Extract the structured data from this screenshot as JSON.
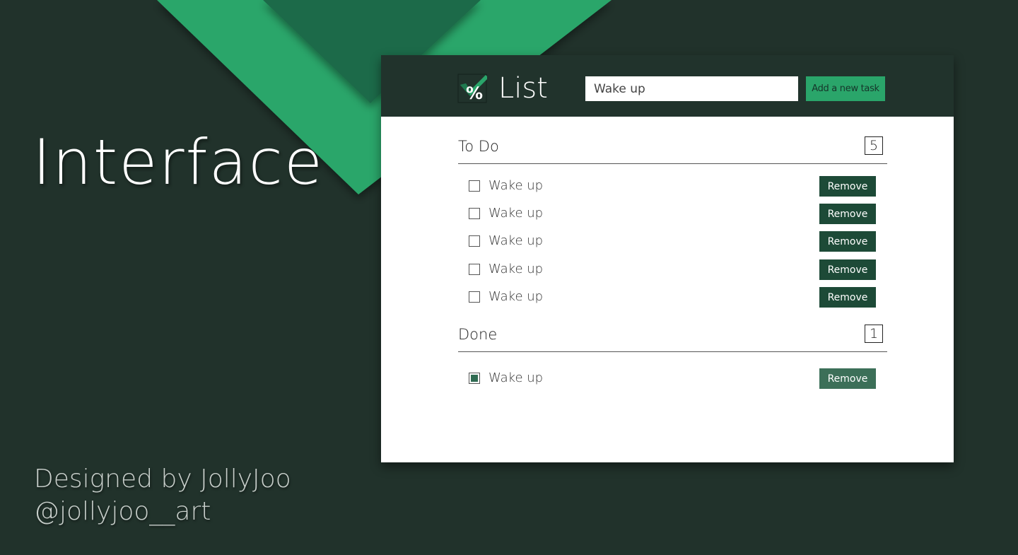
{
  "hero": {
    "title": "Interface",
    "credit_line1": "Designed by JollyJoo",
    "credit_line2": "@jollyjoo__art"
  },
  "app": {
    "title": "List",
    "logo_icon": "checkmark-percent-logo",
    "input_value": "Wake up",
    "add_button_label": "Add a new task"
  },
  "todo": {
    "title": "To Do",
    "count": "5",
    "tasks": [
      {
        "label": "Wake up",
        "checked": false,
        "remove_label": "Remove"
      },
      {
        "label": "Wake up",
        "checked": false,
        "remove_label": "Remove"
      },
      {
        "label": "Wake up",
        "checked": false,
        "remove_label": "Remove"
      },
      {
        "label": "Wake up",
        "checked": false,
        "remove_label": "Remove"
      },
      {
        "label": "Wake up",
        "checked": false,
        "remove_label": "Remove"
      }
    ]
  },
  "done": {
    "title": "Done",
    "count": "1",
    "tasks": [
      {
        "label": "Wake up",
        "checked": true,
        "remove_label": "Remove"
      }
    ]
  },
  "colors": {
    "background": "#21322b",
    "header": "#21332c",
    "accent": "#2aa56a",
    "remove_button": "#1d4a37",
    "remove_button_done": "#3c6f58"
  }
}
